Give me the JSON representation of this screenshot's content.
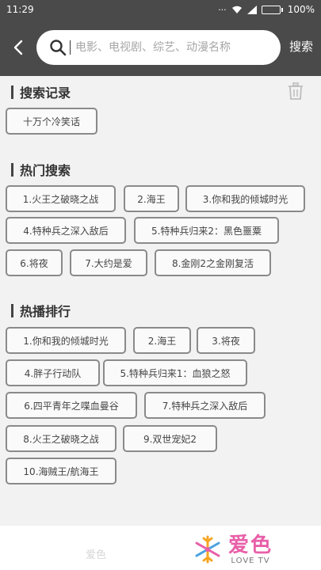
{
  "statusbar": {
    "time": "11:29",
    "battery": "100%",
    "battery_level": 1.0,
    "icons": [
      "signal-dots-icon",
      "wifi-icon",
      "signal-icon",
      "battery-icon"
    ]
  },
  "header": {
    "search_placeholder": "电影、电视剧、综艺、动漫名称",
    "search_button": "搜索",
    "background": "#4a4a4a"
  },
  "history": {
    "title": "搜索记录",
    "items": [
      "十万个冷笑话"
    ]
  },
  "hot_search": {
    "title": "热门搜索",
    "items": [
      "1.火王之破晓之战",
      "2.海王",
      "3.你和我的倾城时光",
      "4.特种兵之深入敌后",
      "5.特种兵归来2：黑色噩粟",
      "6.将夜",
      "7.大约是爱",
      "8.金刚2之金刚复活"
    ]
  },
  "hot_play": {
    "title": "热播排行",
    "items": [
      "1.你和我的倾城时光",
      "2.海王",
      "3.将夜",
      "4.胖子行动队",
      "5.特种兵归来1：血狼之怒",
      "6.四平青年之喋血曼谷",
      "7.特种兵之深入敌后",
      "8.火王之破晓之战",
      "9.双世宠妃2",
      "10.海贼王/航海王"
    ]
  },
  "watermark": {
    "faded_text": "爱色",
    "logo_text": "爱色",
    "logo_sub": "LOVE TV",
    "accent": "#e85fa8"
  }
}
